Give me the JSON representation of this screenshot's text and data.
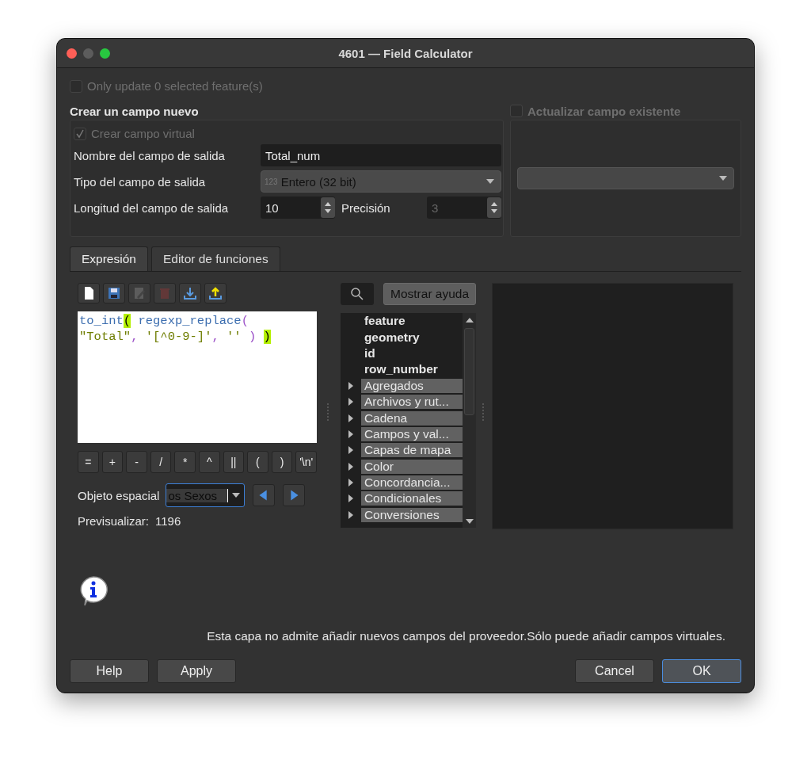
{
  "window": {
    "title": "4601 — Field Calculator"
  },
  "only_update": {
    "label": "Only update 0 selected feature(s)",
    "checked": false,
    "disabled": true
  },
  "create_new": {
    "title": "Crear un campo nuevo",
    "virtual": {
      "label": "Crear campo virtual",
      "checked": true,
      "disabled": true
    },
    "name_label": "Nombre del campo de salida",
    "name_value": "Total_num",
    "type_label": "Tipo del campo de salida",
    "type_icon": "123",
    "type_value": "Entero (32 bit)",
    "length_label": "Longitud del campo de salida",
    "length_value": "10",
    "precision_label": "Precisión",
    "precision_value": "3",
    "precision_disabled": true
  },
  "update_existing": {
    "label": "Actualizar campo existente",
    "checked": false,
    "disabled": true
  },
  "tabs": [
    {
      "label": "Expresión",
      "selected": true
    },
    {
      "label": "Editor de funciones",
      "selected": false
    }
  ],
  "toolbar": [
    {
      "kind": "new",
      "disabled": false
    },
    {
      "kind": "save",
      "disabled": false
    },
    {
      "kind": "edit",
      "disabled": true
    },
    {
      "kind": "delete",
      "disabled": true
    },
    {
      "kind": "import",
      "disabled": false
    },
    {
      "kind": "export",
      "disabled": false
    }
  ],
  "editor": {
    "lines": [
      [
        {
          "text": "to_int",
          "kind": "function"
        },
        {
          "text": "(",
          "kind": "match"
        },
        {
          "text": " regexp_replace",
          "kind": "function"
        },
        {
          "text": "(",
          "kind": "punct"
        }
      ],
      [
        {
          "text": "\"Total\"",
          "kind": "field"
        },
        {
          "text": ", ",
          "kind": "punct"
        },
        {
          "text": "'[^0-9-]'",
          "kind": "string"
        },
        {
          "text": ", ",
          "kind": "punct"
        },
        {
          "text": "''",
          "kind": "string"
        },
        {
          "text": " ) ",
          "kind": "punct"
        },
        {
          "text": ")",
          "kind": "match"
        }
      ]
    ]
  },
  "operators": [
    "=",
    "+",
    "-",
    "/",
    "*",
    "^",
    "||",
    "(",
    ")",
    "'\\n'"
  ],
  "feature_label": "Objeto espacial",
  "feature_value": "os Sexos",
  "preview_label": "Previsualizar:",
  "preview_value": "1196",
  "help_button": {
    "label": "Mostrar ayuda",
    "disabled": true
  },
  "functions": [
    {
      "label": "feature",
      "kind": "field"
    },
    {
      "label": "geometry",
      "kind": "field"
    },
    {
      "label": "id",
      "kind": "field"
    },
    {
      "label": "row_number",
      "kind": "field"
    },
    {
      "label": "Agregados",
      "kind": "group"
    },
    {
      "label": "Archivos y rut...",
      "kind": "group"
    },
    {
      "label": "Cadena",
      "kind": "group"
    },
    {
      "label": "Campos y val...",
      "kind": "group"
    },
    {
      "label": "Capas de mapa",
      "kind": "group"
    },
    {
      "label": "Color",
      "kind": "group"
    },
    {
      "label": "Concordancia...",
      "kind": "group"
    },
    {
      "label": "Condicionales",
      "kind": "group"
    },
    {
      "label": "Conversiones",
      "kind": "group"
    }
  ],
  "message": "Esta capa no admite añadir nuevos campos del proveedor.Sólo puede añadir campos virtuales.",
  "buttons_left": [
    {
      "label": "Help",
      "default": false
    },
    {
      "label": "Apply",
      "default": false
    }
  ],
  "buttons_right": [
    {
      "label": "Cancel",
      "default": false
    },
    {
      "label": "OK",
      "default": true
    }
  ]
}
